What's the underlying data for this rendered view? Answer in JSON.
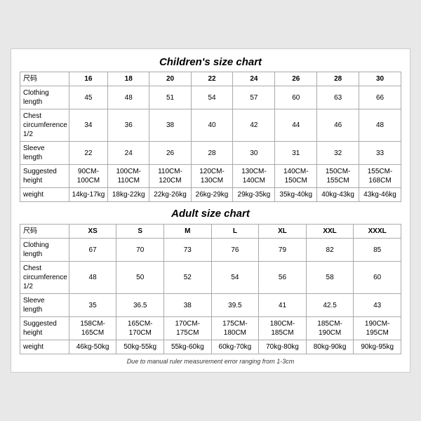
{
  "children_chart": {
    "title": "Children's size chart",
    "columns": [
      "尺码",
      "16",
      "18",
      "20",
      "22",
      "24",
      "26",
      "28",
      "30"
    ],
    "rows": [
      {
        "label": "Clothing\nlength",
        "values": [
          "45",
          "48",
          "51",
          "54",
          "57",
          "60",
          "63",
          "66"
        ]
      },
      {
        "label": "Chest\ncircumference\n1/2",
        "values": [
          "34",
          "36",
          "38",
          "40",
          "42",
          "44",
          "46",
          "48"
        ]
      },
      {
        "label": "Sleeve\nlength",
        "values": [
          "22",
          "24",
          "26",
          "28",
          "30",
          "31",
          "32",
          "33"
        ]
      },
      {
        "label": "Suggested\nheight",
        "values": [
          "90CM-100CM",
          "100CM-110CM",
          "110CM-120CM",
          "120CM-130CM",
          "130CM-140CM",
          "140CM-150CM",
          "150CM-155CM",
          "155CM-168CM"
        ]
      },
      {
        "label": "weight",
        "values": [
          "14kg-17kg",
          "18kg-22kg",
          "22kg-26kg",
          "26kg-29kg",
          "29kg-35kg",
          "35kg-40kg",
          "40kg-43kg",
          "43kg-46kg"
        ]
      }
    ]
  },
  "adult_chart": {
    "title": "Adult size chart",
    "columns": [
      "尺码",
      "XS",
      "S",
      "M",
      "L",
      "XL",
      "XXL",
      "XXXL"
    ],
    "rows": [
      {
        "label": "Clothing\nlength",
        "values": [
          "67",
          "70",
          "73",
          "76",
          "79",
          "82",
          "85"
        ]
      },
      {
        "label": "Chest\ncircumference\n1/2",
        "values": [
          "48",
          "50",
          "52",
          "54",
          "56",
          "58",
          "60"
        ]
      },
      {
        "label": "Sleeve\nlength",
        "values": [
          "35",
          "36.5",
          "38",
          "39.5",
          "41",
          "42.5",
          "43"
        ]
      },
      {
        "label": "Suggested\nheight",
        "values": [
          "158CM-165CM",
          "165CM-170CM",
          "170CM-175CM",
          "175CM-180CM",
          "180CM-185CM",
          "185CM-190CM",
          "190CM-195CM"
        ]
      },
      {
        "label": "weight",
        "values": [
          "46kg-50kg",
          "50kg-55kg",
          "55kg-60kg",
          "60kg-70kg",
          "70kg-80kg",
          "80kg-90kg",
          "90kg-95kg"
        ]
      }
    ]
  },
  "footer_note": "Due to manual ruler measurement error ranging from 1-3cm"
}
